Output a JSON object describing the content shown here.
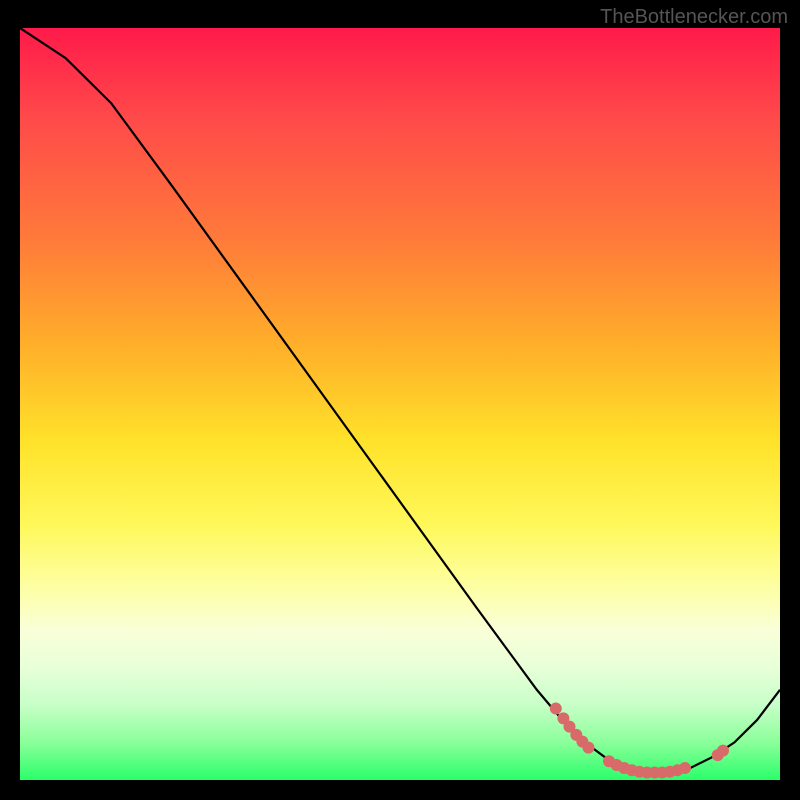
{
  "watermark": "TheBottlenecker.com",
  "chart_data": {
    "type": "line",
    "title": "",
    "xlabel": "",
    "ylabel": "",
    "xlim": [
      0,
      100
    ],
    "ylim": [
      0,
      100
    ],
    "curve": [
      {
        "x": 0,
        "y": 100
      },
      {
        "x": 6,
        "y": 96
      },
      {
        "x": 12,
        "y": 90
      },
      {
        "x": 20,
        "y": 79
      },
      {
        "x": 30,
        "y": 65
      },
      {
        "x": 40,
        "y": 51
      },
      {
        "x": 50,
        "y": 37
      },
      {
        "x": 60,
        "y": 23
      },
      {
        "x": 68,
        "y": 12
      },
      {
        "x": 73,
        "y": 6
      },
      {
        "x": 77,
        "y": 3
      },
      {
        "x": 80,
        "y": 1.5
      },
      {
        "x": 84,
        "y": 1
      },
      {
        "x": 88,
        "y": 1.5
      },
      {
        "x": 91,
        "y": 3
      },
      {
        "x": 94,
        "y": 5
      },
      {
        "x": 97,
        "y": 8
      },
      {
        "x": 100,
        "y": 12
      }
    ],
    "markers": [
      {
        "x": 70.5,
        "y": 9.5
      },
      {
        "x": 71.5,
        "y": 8.2
      },
      {
        "x": 72.3,
        "y": 7.1
      },
      {
        "x": 73.2,
        "y": 6.0
      },
      {
        "x": 74.0,
        "y": 5.1
      },
      {
        "x": 74.8,
        "y": 4.3
      },
      {
        "x": 77.5,
        "y": 2.5
      },
      {
        "x": 78.5,
        "y": 2.0
      },
      {
        "x": 79.5,
        "y": 1.6
      },
      {
        "x": 80.5,
        "y": 1.3
      },
      {
        "x": 81.5,
        "y": 1.1
      },
      {
        "x": 82.5,
        "y": 1.0
      },
      {
        "x": 83.5,
        "y": 1.0
      },
      {
        "x": 84.5,
        "y": 1.0
      },
      {
        "x": 85.5,
        "y": 1.1
      },
      {
        "x": 86.5,
        "y": 1.3
      },
      {
        "x": 87.5,
        "y": 1.6
      },
      {
        "x": 91.8,
        "y": 3.3
      },
      {
        "x": 92.5,
        "y": 3.9
      }
    ],
    "marker_color": "#d86a6a",
    "line_color": "#000000"
  }
}
